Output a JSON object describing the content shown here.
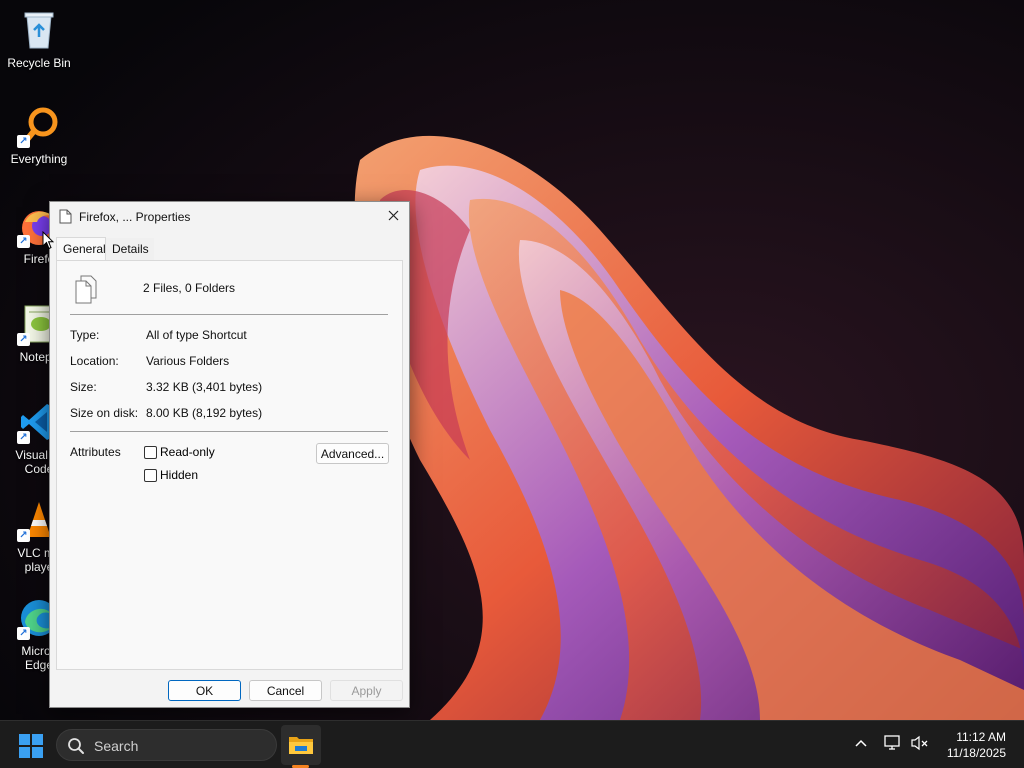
{
  "desktop": {
    "icons": [
      {
        "label": "Recycle Bin",
        "icon": "recycle-bin-icon"
      },
      {
        "label": "Everything",
        "icon": "everything-search-icon"
      },
      {
        "label": "Firefo",
        "icon": "firefox-icon"
      },
      {
        "label": "Notepa",
        "icon": "notepad-plus-plus-icon"
      },
      {
        "label": "Visual St\nCode",
        "icon": "vscode-icon"
      },
      {
        "label": "VLC me\nplaye",
        "icon": "vlc-icon"
      },
      {
        "label": "Micros\nEdge",
        "icon": "edge-icon"
      }
    ]
  },
  "dialog": {
    "title": "Firefox, ... Properties",
    "tabs": [
      {
        "label": "General",
        "active": true
      },
      {
        "label": "Details",
        "active": false
      }
    ],
    "summary": "2 Files, 0 Folders",
    "type_label": "Type:",
    "type_value": "All of type Shortcut",
    "location_label": "Location:",
    "location_value": "Various Folders",
    "size_label": "Size:",
    "size_value": "3.32 KB (3,401 bytes)",
    "size_on_disk_label": "Size on disk:",
    "size_on_disk_value": "8.00 KB (8,192 bytes)",
    "attributes_label": "Attributes",
    "readonly_label": "Read-only",
    "readonly_checked": false,
    "hidden_label": "Hidden",
    "hidden_checked": false,
    "advanced_label": "Advanced...",
    "ok_label": "OK",
    "cancel_label": "Cancel",
    "apply_label": "Apply"
  },
  "taskbar": {
    "search_placeholder": "Search",
    "time": "11:12 AM",
    "date": "11/18/2025"
  },
  "colors": {
    "accent": "#0067c0",
    "taskbar": "#1c1c1c",
    "dialog_bg": "#f3f3f3"
  }
}
